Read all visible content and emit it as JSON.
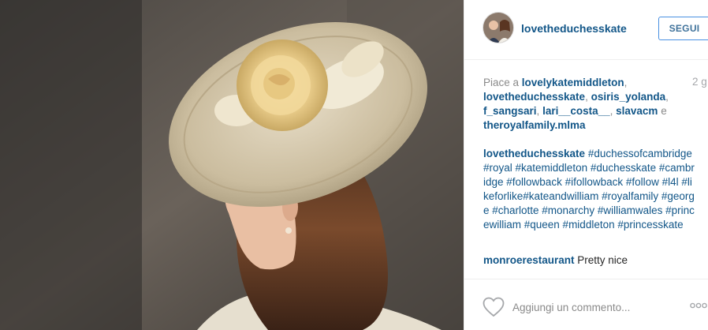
{
  "post": {
    "image_alt": "Woman wearing a cream wide-brimmed hat with a fabric rose"
  },
  "header": {
    "username": "lovetheduchesskate",
    "follow_label": "SEGUI"
  },
  "likes": {
    "prefix": "Piace a ",
    "users": [
      "lovelykatemiddleton",
      "lovetheduchesskate",
      "osiris_yolanda",
      "f_sangsari",
      "lari__costa__",
      "slavacm"
    ],
    "conjunction": " e ",
    "last_user": "theroyalfamily.mlma"
  },
  "time_ago": "2 g",
  "caption": {
    "username": "lovetheduchesskate",
    "text": " #duchessofcambridge #royal #katemiddleton #duchesskate #cambridge #followback #ifollowback #follow #l4l #likeforlike#kateandwilliam #royalfamily #george #charlotte #monarchy #williamwales #princewilliam #queen #middleton #princesskate"
  },
  "comment": {
    "username": "monroerestaurant",
    "text": " Pretty nice"
  },
  "footer": {
    "comment_placeholder": "Aggiungi un commento..."
  },
  "icons": {
    "like": "heart-icon",
    "more": "more-options-icon"
  },
  "colors": {
    "link": "#125688",
    "follow_border": "#4990e2",
    "muted": "#8a8a8a"
  }
}
